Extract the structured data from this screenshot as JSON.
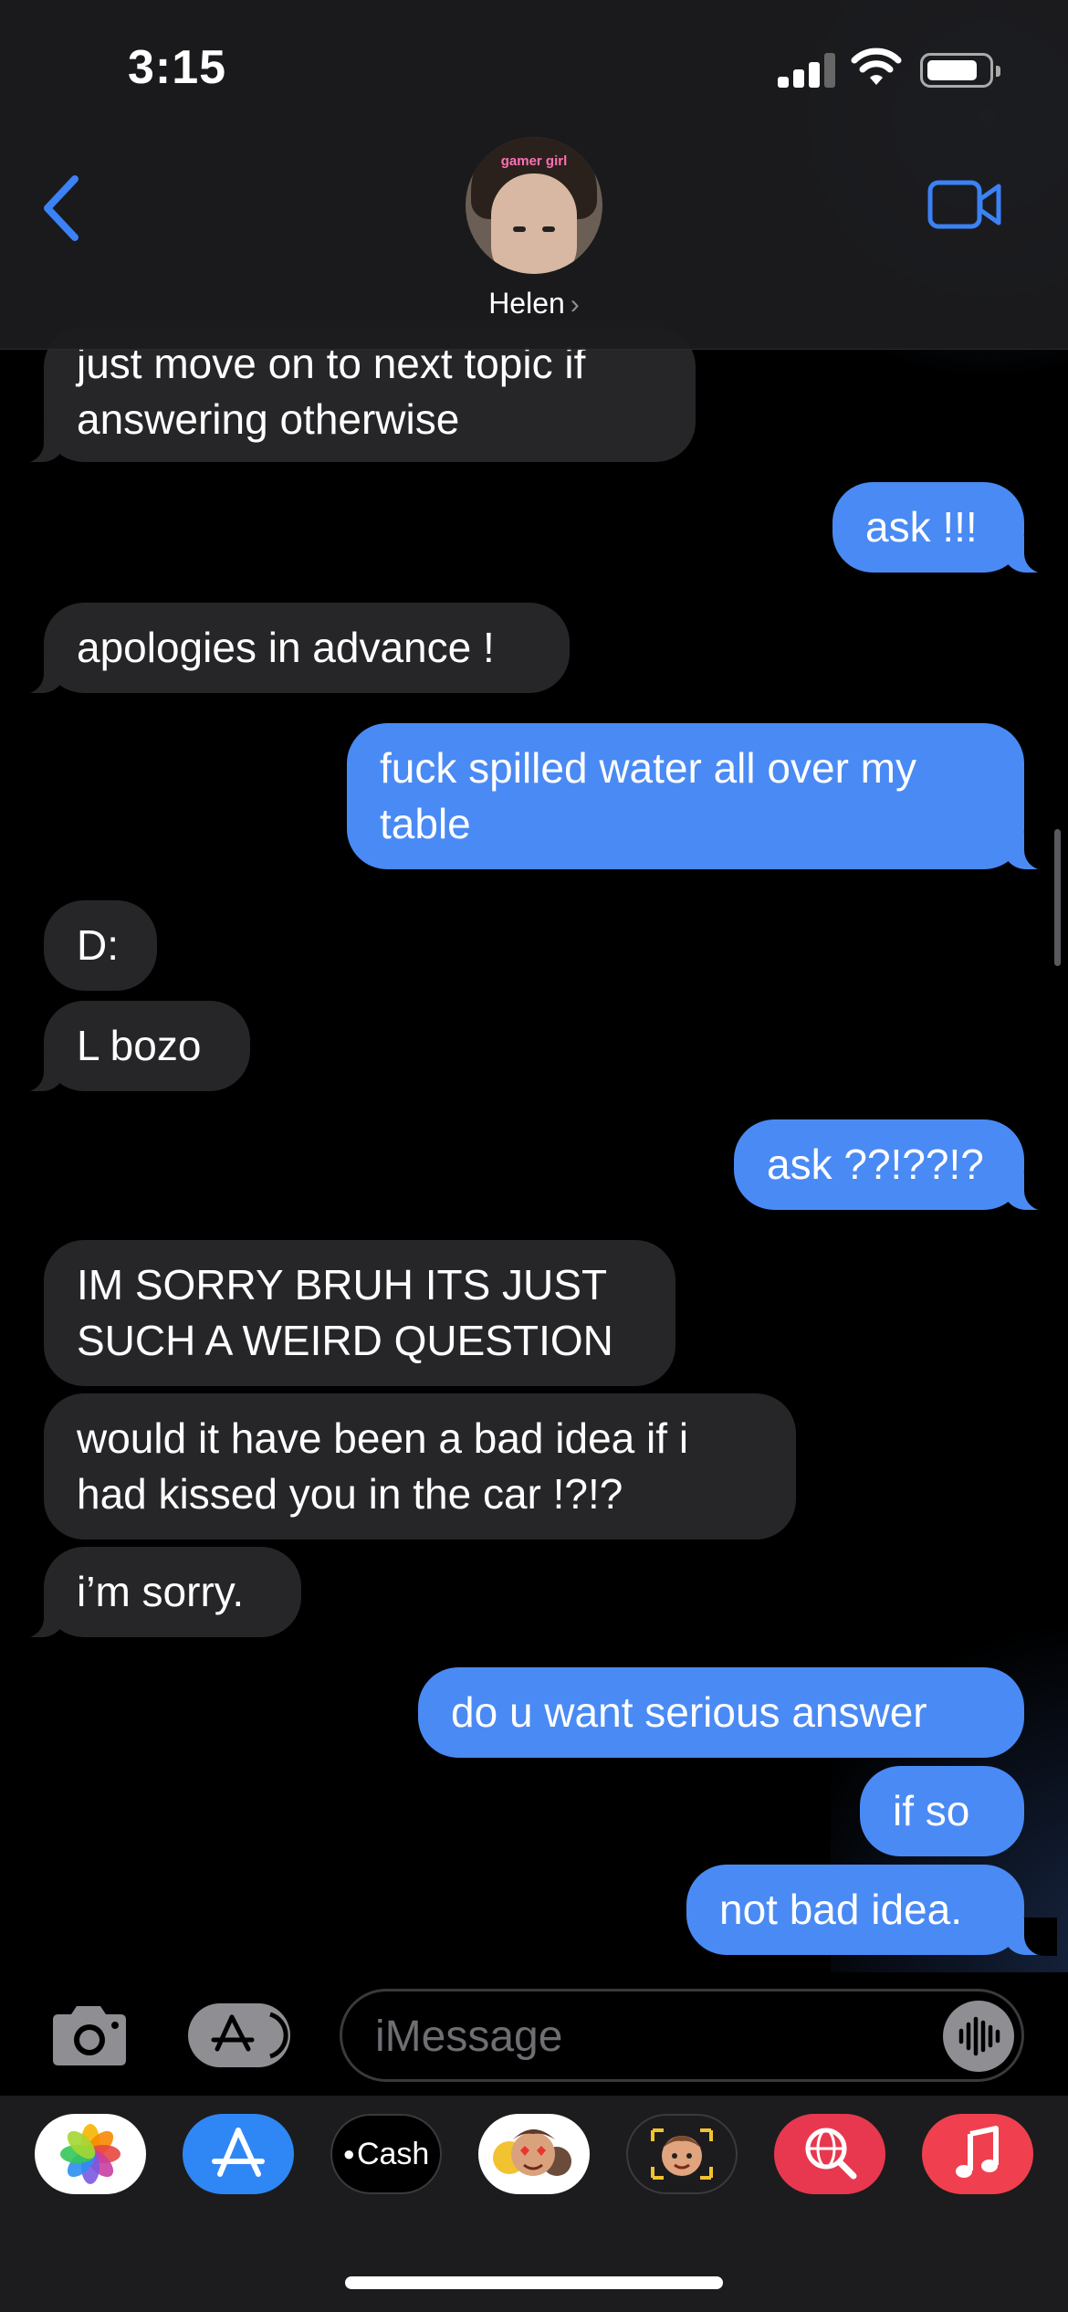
{
  "status_bar": {
    "time": "3:15"
  },
  "header": {
    "contact_name": "Helen",
    "avatar_caption": "gamer girl"
  },
  "messages": [
    {
      "side": "in",
      "lines": [
        "just move on to next topic if",
        "answering otherwise"
      ],
      "tail": true
    },
    {
      "side": "out",
      "lines": [
        "ask !!!"
      ],
      "tail": true
    },
    {
      "side": "in",
      "lines": [
        "apologies in advance !"
      ],
      "tail": true
    },
    {
      "side": "out",
      "lines": [
        "fuck spilled water all over my",
        "table"
      ],
      "tail": true
    },
    {
      "side": "in",
      "lines": [
        "D:"
      ],
      "tail": false
    },
    {
      "side": "in",
      "lines": [
        "L bozo"
      ],
      "tail": true
    },
    {
      "side": "out",
      "lines": [
        "ask ??!??!?"
      ],
      "tail": true
    },
    {
      "side": "in",
      "lines": [
        "IM SORRY BRUH ITS JUST",
        "SUCH A WEIRD QUESTION"
      ],
      "tail": false
    },
    {
      "side": "in",
      "lines": [
        "would it have been a bad idea if i",
        "had kissed you in the car !?!?"
      ],
      "tail": false
    },
    {
      "side": "in",
      "lines": [
        "i’m sorry."
      ],
      "tail": true
    },
    {
      "side": "out",
      "lines": [
        "do u want serious answer"
      ],
      "tail": false
    },
    {
      "side": "out",
      "lines": [
        "if so"
      ],
      "tail": false
    },
    {
      "side": "out",
      "lines": [
        "not bad idea."
      ],
      "tail": true
    }
  ],
  "composer": {
    "placeholder": "iMessage"
  },
  "app_drawer": [
    {
      "name": "photos",
      "label": ""
    },
    {
      "name": "app-store",
      "label": ""
    },
    {
      "name": "apple-cash",
      "label": "Cash"
    },
    {
      "name": "memoji-stickers",
      "label": ""
    },
    {
      "name": "memoji",
      "label": ""
    },
    {
      "name": "images-search",
      "label": ""
    },
    {
      "name": "music",
      "label": ""
    }
  ],
  "colors": {
    "outgoing_bubble": "#4a8af4",
    "incoming_bubble": "#262628",
    "accent": "#3b82f6",
    "background": "#000000"
  }
}
